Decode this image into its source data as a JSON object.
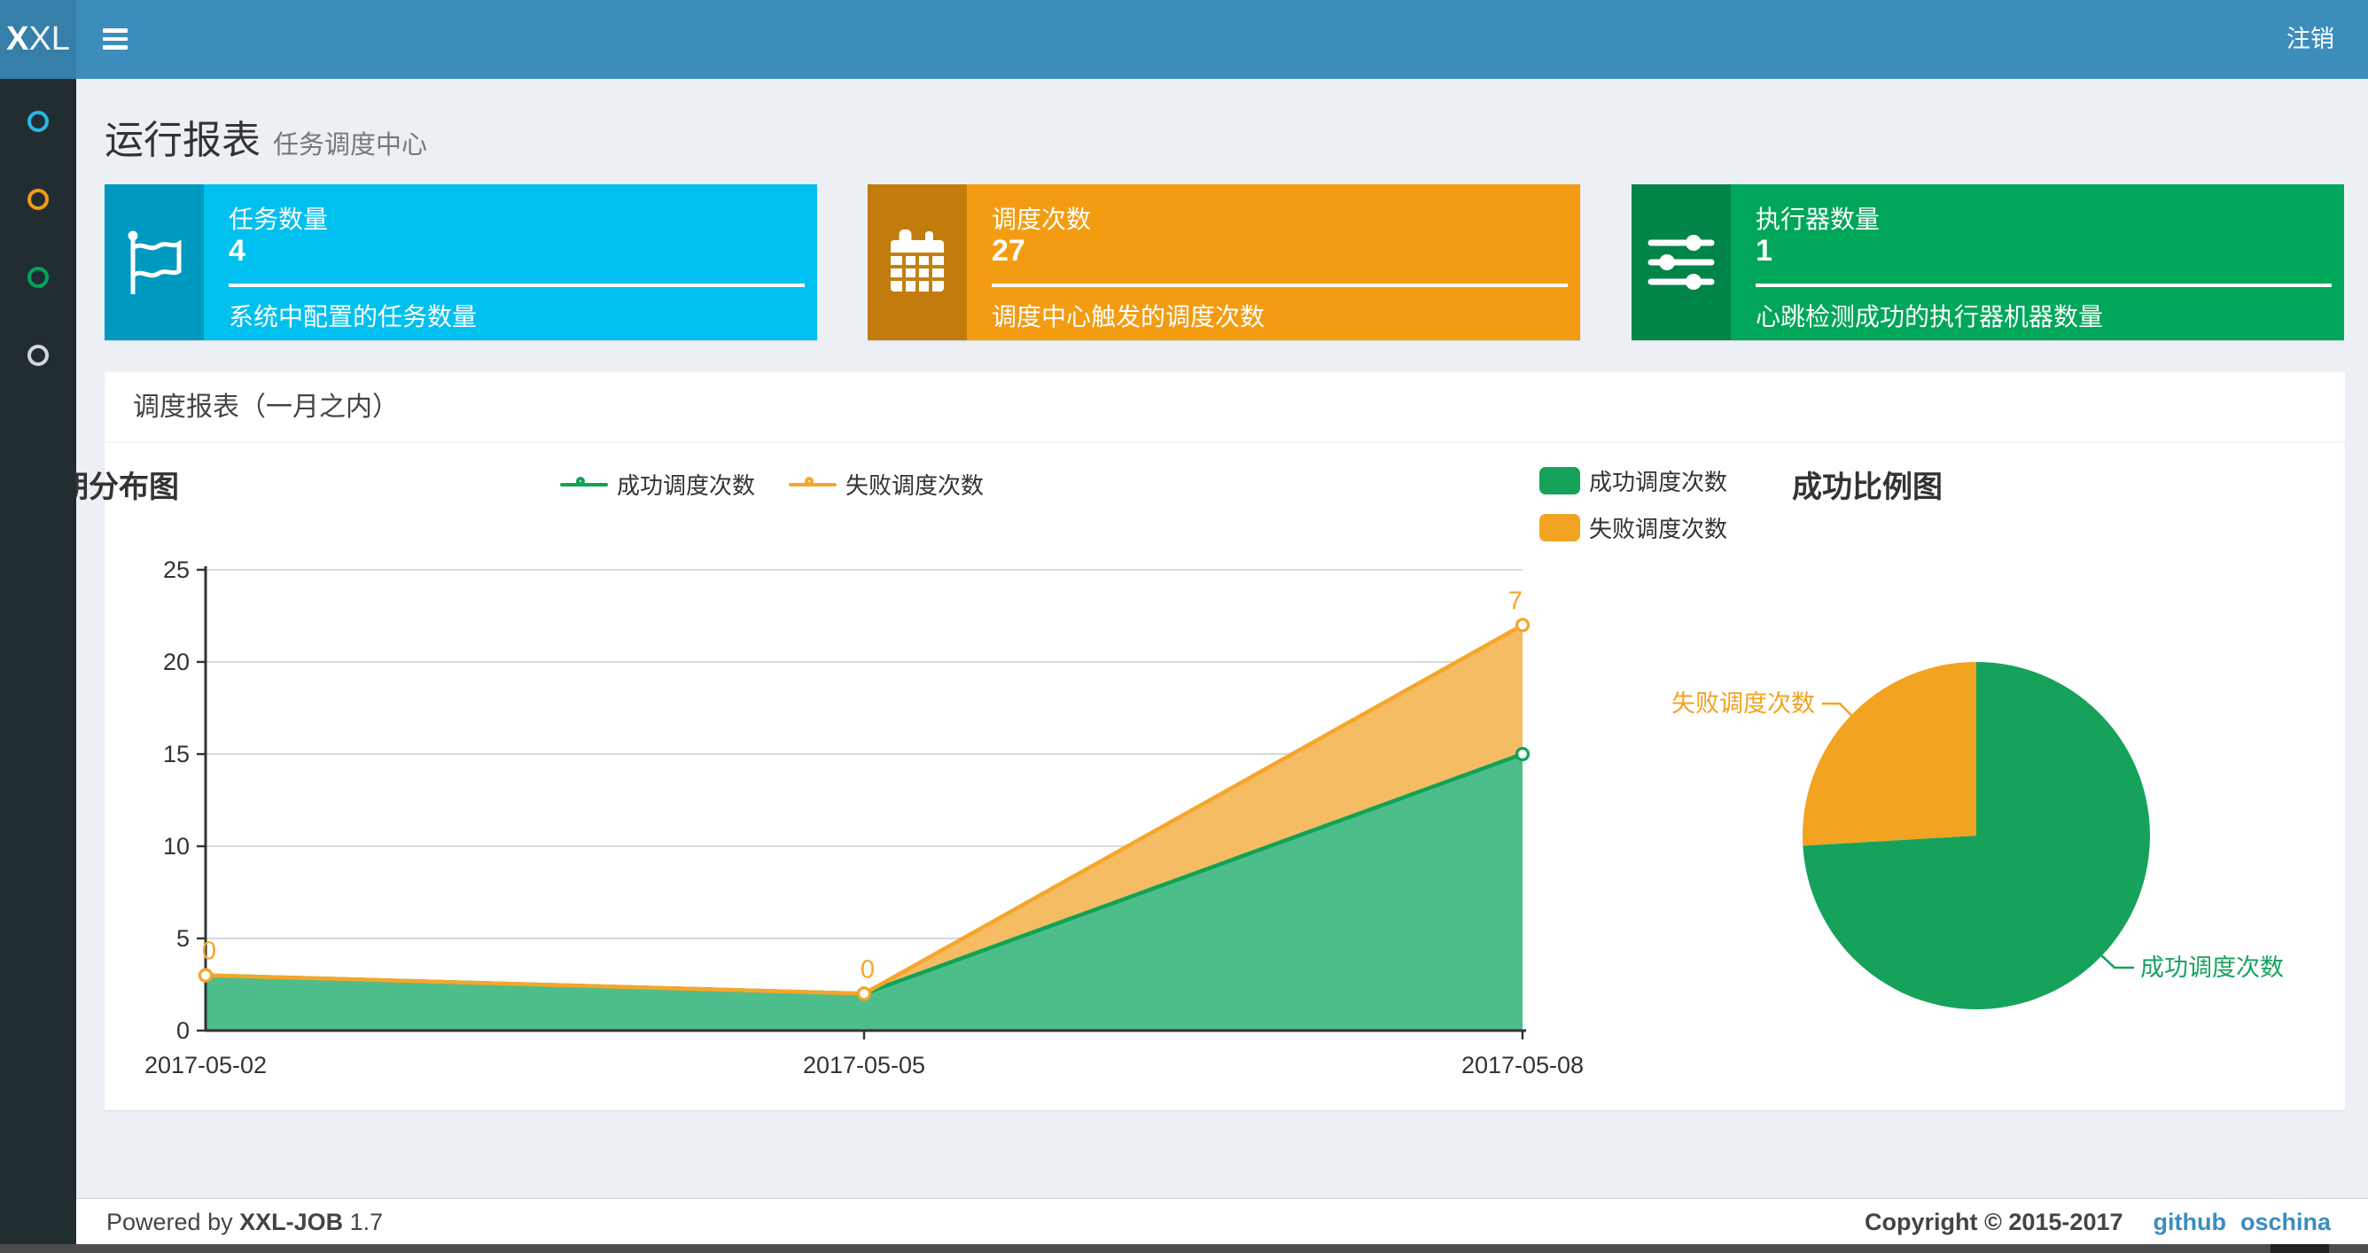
{
  "navbar": {
    "logo_bold": "X",
    "logo_light": "XL",
    "logout_label": "注销"
  },
  "sidebar": {
    "items": [
      {
        "name": "menu-dot-aqua",
        "icon": "circle-o-icon",
        "color": "#29b7e8"
      },
      {
        "name": "menu-dot-yellow",
        "icon": "circle-o-icon",
        "color": "#f39c12"
      },
      {
        "name": "menu-dot-green",
        "icon": "circle-o-icon",
        "color": "#00a65a"
      },
      {
        "name": "menu-dot-white",
        "icon": "circle-o-icon",
        "color": "#d2d6de"
      }
    ]
  },
  "page_header": {
    "title": "运行报表",
    "subtitle": "任务调度中心"
  },
  "info_boxes": [
    {
      "title": "任务数量",
      "value": "4",
      "description": "系统中配置的任务数量",
      "bg": "#00c0ef",
      "icon": "flag-icon"
    },
    {
      "title": "调度次数",
      "value": "27",
      "description": "调度中心触发的调度次数",
      "bg": "#f39c12",
      "icon": "calendar-icon"
    },
    {
      "title": "执行器数量",
      "value": "1",
      "description": "心跳检测成功的执行器机器数量",
      "bg": "#00a65a",
      "icon": "sliders-icon"
    }
  ],
  "panel": {
    "title": "调度报表（一月之内）"
  },
  "chart_data": [
    {
      "type": "area",
      "title": "日期分布图",
      "categories": [
        "2017-05-02",
        "2017-05-05",
        "2017-05-08"
      ],
      "stacked": true,
      "series": [
        {
          "name": "成功调度次数",
          "values": [
            3,
            2,
            15
          ],
          "color": "#10a356",
          "fill": "#4dbd8c"
        },
        {
          "name": "失败调度次数",
          "values": [
            0,
            0,
            7
          ],
          "color": "#f5a62a",
          "fill": "#f5bc63",
          "show_labels": true
        }
      ],
      "ylim": [
        0,
        25
      ],
      "ytick_step": 5,
      "grid": true,
      "legend_position": "top-center"
    },
    {
      "type": "pie",
      "title": "成功比例图",
      "slices": [
        {
          "name": "成功调度次数",
          "value": 20,
          "color": "#17a25c"
        },
        {
          "name": "失败调度次数",
          "value": 7,
          "color": "#f2a321"
        }
      ],
      "legend_position": "top-left"
    }
  ],
  "footer": {
    "powered_prefix": "Powered by",
    "product": "XXL-JOB",
    "version": "1.7",
    "copyright": "Copyright © 2015-2017",
    "links": [
      {
        "label": "github"
      },
      {
        "label": "oschina"
      }
    ]
  },
  "colors": {
    "navbar": "#3c8dbc",
    "logo_bg": "#367fa9",
    "sidebar_bg": "#222d32",
    "content_bg": "#ecf0f5",
    "axis": "#333333",
    "gridline": "#cccccc"
  }
}
